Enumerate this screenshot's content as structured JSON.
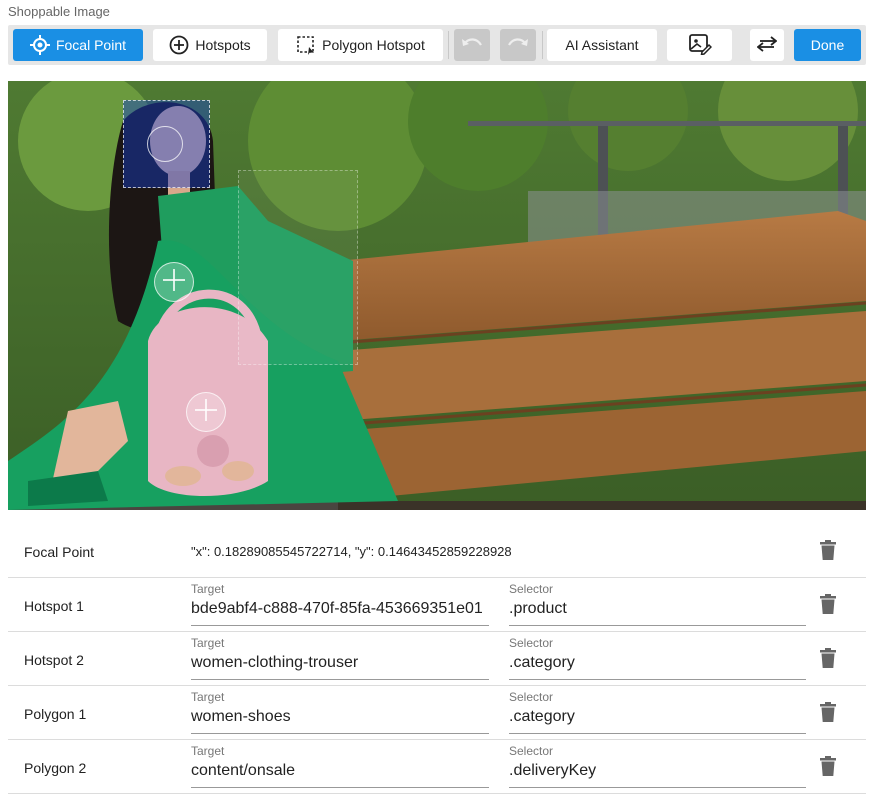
{
  "app": {
    "title": "Shoppable Image"
  },
  "toolbar": {
    "focal_point": {
      "label": "Focal Point",
      "icon": "crosshair-icon",
      "active": true
    },
    "hotspots": {
      "label": "Hotspots",
      "icon": "plus-circle-icon"
    },
    "polygon_hotspot": {
      "label": "Polygon Hotspot",
      "icon": "dashed-square-icon"
    },
    "undo": {
      "icon": "undo-icon",
      "disabled": true
    },
    "redo": {
      "icon": "redo-icon",
      "disabled": true
    },
    "ai_assistant": {
      "label": "AI Assistant"
    },
    "edit_image": {
      "icon": "image-edit-icon"
    },
    "swap": {
      "icon": "swap-arrows-icon"
    },
    "done": {
      "label": "Done"
    }
  },
  "colors": {
    "accent": "#1a8fe4",
    "toolbar_bg": "#e6e6e6",
    "disabled": "#c8c8c8"
  },
  "focal_point": {
    "label": "Focal Point",
    "value": "\"x\": 0.18289085545722714, \"y\": 0.14643452859228928"
  },
  "field_labels": {
    "target": "Target",
    "selector": "Selector"
  },
  "items": [
    {
      "label": "Hotspot 1",
      "target": "bde9abf4-c888-470f-85fa-453669351e01",
      "selector": ".product"
    },
    {
      "label": "Hotspot 2",
      "target": "women-clothing-trouser",
      "selector": ".category"
    },
    {
      "label": "Polygon 1",
      "target": "women-shoes",
      "selector": ".category"
    },
    {
      "label": "Polygon 2",
      "target": "content/onsale",
      "selector": ".deliveryKey"
    }
  ]
}
